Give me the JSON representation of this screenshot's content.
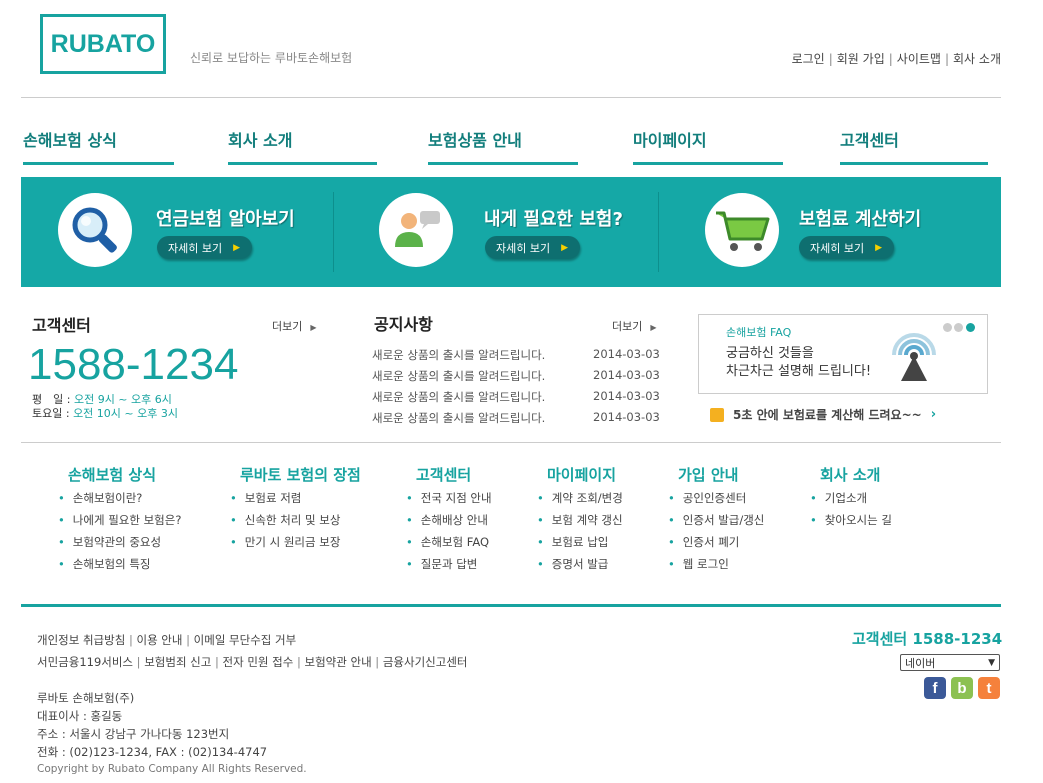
{
  "header": {
    "logo": "RUBATO",
    "slogan": "신뢰로 보답하는 루바토손해보험",
    "links": [
      "로그인",
      "회원 가입",
      "사이트맵",
      "회사 소개"
    ]
  },
  "nav": [
    "손해보험 상식",
    "회사 소개",
    "보험상품 안내",
    "마이페이지",
    "고객센터"
  ],
  "banner": [
    {
      "title": "연금보험 알아보기",
      "button": "자세히 보기",
      "icon": "magnifier-icon"
    },
    {
      "title": "내게 필요한 보험?",
      "button": "자세히 보기",
      "icon": "person-chat-icon"
    },
    {
      "title": "보험료 계산하기",
      "button": "자세히 보기",
      "icon": "cart-icon"
    }
  ],
  "customer_center": {
    "title": "고객센터",
    "more": "더보기",
    "phone": "1588-1234",
    "weekday_label": "평　일 : ",
    "weekday_hours": "오전  9시 ~ 오후 6시",
    "saturday_label": "토요일 : ",
    "saturday_hours": "오전 10시 ~ 오후 3시"
  },
  "notice": {
    "title": "공지사항",
    "more": "더보기",
    "items": [
      {
        "text": "새로운 상품의 출시를 알려드립니다.",
        "date": "2014-03-03"
      },
      {
        "text": "새로운 상품의 출시를 알려드립니다.",
        "date": "2014-03-03"
      },
      {
        "text": "새로운 상품의 출시를 알려드립니다.",
        "date": "2014-03-03"
      },
      {
        "text": "새로운 상품의 출시를 알려드립니다.",
        "date": "2014-03-03"
      }
    ]
  },
  "faq": {
    "title": "손해보험 FAQ",
    "line1": "궁금하신 것들을",
    "line2": "차근차근 설명해 드립니다!"
  },
  "calc_promo": "5초 안에 보험료를 계산해 드려요~~",
  "sitemap": [
    {
      "title": "손해보험 상식",
      "items": [
        "손해보험이란?",
        "나에게 필요한 보험은?",
        "보험약관의 중요성",
        "손해보험의 특징"
      ]
    },
    {
      "title": "루바토 보험의 장점",
      "items": [
        "보험료 저렴",
        "신속한 처리 및 보상",
        "만기 시 원리금 보장"
      ]
    },
    {
      "title": "고객센터",
      "items": [
        "전국 지점 안내",
        "손해배상 안내",
        "손해보험 FAQ",
        "질문과 답변"
      ]
    },
    {
      "title": "마이페이지",
      "items": [
        "계약 조회/변경",
        "보험 계약 갱신",
        "보험료 납입",
        "증명서 발급"
      ]
    },
    {
      "title": "가입 안내",
      "items": [
        "공인인증센터",
        "인증서 발급/갱신",
        "인증서 폐기",
        "웹 로그인"
      ]
    },
    {
      "title": "회사 소개",
      "items": [
        "기업소개",
        "찾아오시는 길"
      ]
    }
  ],
  "footer": {
    "links1": [
      "개인정보 취급방침",
      "이용 안내",
      "이메일 무단수집 거부"
    ],
    "links2": [
      "서민금융119서비스",
      "보험범죄 신고",
      "전자 민원 접수",
      "보험약관 안내",
      "금융사기신고센터"
    ],
    "company": "루바토 손해보험(주)",
    "ceo": "대표이사 : 홍길동",
    "address": "주소 : 서울시 강남구 가나다동 123번지",
    "contact": "전화 : (02)123-1234, FAX : (02)134-4747",
    "copyright": "Copyright by Rubato Company All Rights Reserved.",
    "cc_label": "고객센터 1588-1234",
    "select_value": "네이버",
    "social": [
      {
        "label": "f",
        "color": "#3b5998",
        "icon": "facebook-icon"
      },
      {
        "label": "b",
        "color": "#8cc152",
        "icon": "blog-icon"
      },
      {
        "label": "t",
        "color": "#f5813c",
        "icon": "twitter-icon"
      }
    ]
  },
  "colors": {
    "accent": "#17a3a0",
    "banner": "#15a8a6"
  }
}
